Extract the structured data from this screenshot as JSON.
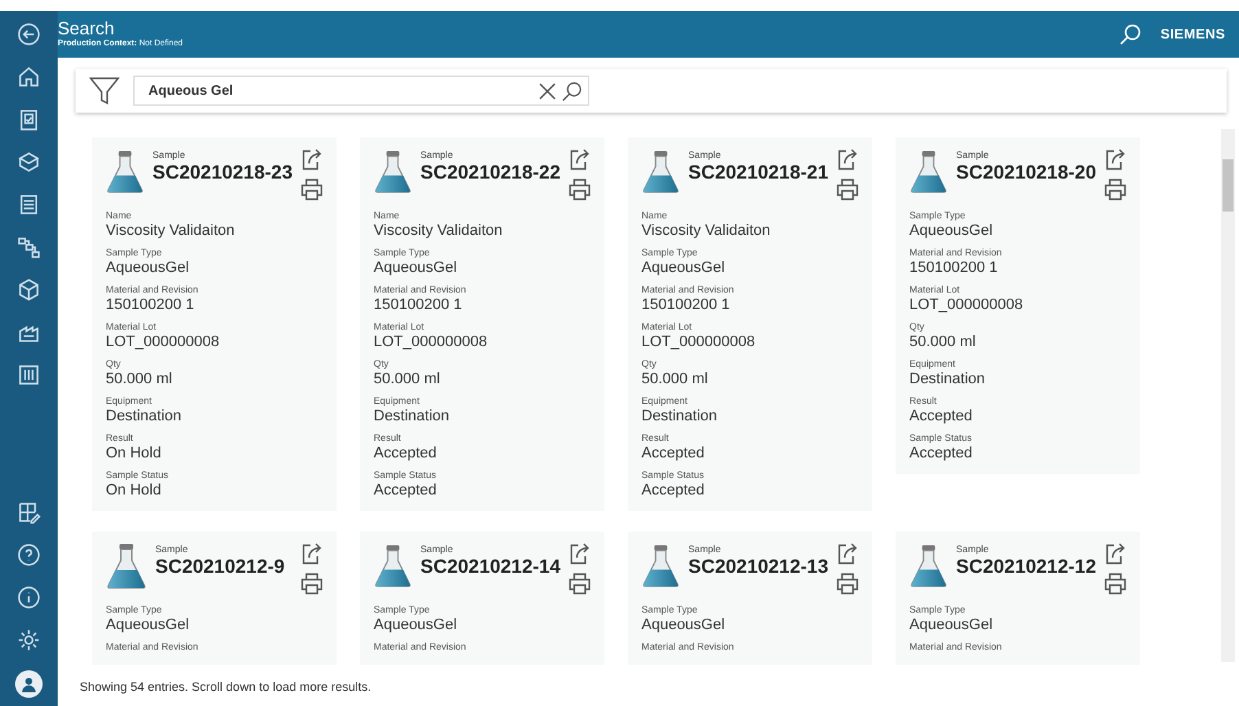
{
  "header": {
    "title": "Search",
    "subtitle": "**Production Context:** Not Defined",
    "brand": "SIEMENS"
  },
  "search": {
    "value": "Aqueous Gel"
  },
  "cards": [
    {
      "caption": "Sample",
      "id": "SC20210218-23",
      "fields": [
        {
          "label": "Name",
          "value": "Viscosity Validaiton"
        },
        {
          "label": "Sample Type",
          "value": "AqueousGel"
        },
        {
          "label": "Material and Revision",
          "value": "150100200 1"
        },
        {
          "label": "Material Lot",
          "value": "LOT_000000008"
        },
        {
          "label": "Qty",
          "value": "50.000 ml"
        },
        {
          "label": "Equipment",
          "value": "Destination"
        },
        {
          "label": "Result",
          "value": "On Hold"
        },
        {
          "label": "Sample Status",
          "value": "On Hold"
        }
      ]
    },
    {
      "caption": "Sample",
      "id": "SC20210218-22",
      "fields": [
        {
          "label": "Name",
          "value": "Viscosity Validaiton"
        },
        {
          "label": "Sample Type",
          "value": "AqueousGel"
        },
        {
          "label": "Material and Revision",
          "value": "150100200 1"
        },
        {
          "label": "Material Lot",
          "value": "LOT_000000008"
        },
        {
          "label": "Qty",
          "value": "50.000 ml"
        },
        {
          "label": "Equipment",
          "value": "Destination"
        },
        {
          "label": "Result",
          "value": "Accepted"
        },
        {
          "label": "Sample Status",
          "value": "Accepted"
        }
      ]
    },
    {
      "caption": "Sample",
      "id": "SC20210218-21",
      "fields": [
        {
          "label": "Name",
          "value": "Viscosity Validaiton"
        },
        {
          "label": "Sample Type",
          "value": "AqueousGel"
        },
        {
          "label": "Material and Revision",
          "value": "150100200 1"
        },
        {
          "label": "Material Lot",
          "value": "LOT_000000008"
        },
        {
          "label": "Qty",
          "value": "50.000 ml"
        },
        {
          "label": "Equipment",
          "value": "Destination"
        },
        {
          "label": "Result",
          "value": "Accepted"
        },
        {
          "label": "Sample Status",
          "value": "Accepted"
        }
      ]
    },
    {
      "caption": "Sample",
      "id": "SC20210218-20",
      "fields": [
        {
          "label": "Sample Type",
          "value": "AqueousGel"
        },
        {
          "label": "Material and Revision",
          "value": "150100200 1"
        },
        {
          "label": "Material Lot",
          "value": "LOT_000000008"
        },
        {
          "label": "Qty",
          "value": "50.000 ml"
        },
        {
          "label": "Equipment",
          "value": "Destination"
        },
        {
          "label": "Result",
          "value": "Accepted"
        },
        {
          "label": "Sample Status",
          "value": "Accepted"
        }
      ]
    },
    {
      "caption": "Sample",
      "id": "SC20210212-9",
      "fields": [
        {
          "label": "Sample Type",
          "value": "AqueousGel"
        },
        {
          "label": "Material and Revision"
        }
      ]
    },
    {
      "caption": "Sample",
      "id": "SC20210212-14",
      "fields": [
        {
          "label": "Sample Type",
          "value": "AqueousGel"
        },
        {
          "label": "Material and Revision"
        }
      ]
    },
    {
      "caption": "Sample",
      "id": "SC20210212-13",
      "fields": [
        {
          "label": "Sample Type",
          "value": "AqueousGel"
        },
        {
          "label": "Material and Revision"
        }
      ]
    },
    {
      "caption": "Sample",
      "id": "SC20210212-12",
      "fields": [
        {
          "label": "Sample Type",
          "value": "AqueousGel"
        },
        {
          "label": "Material and Revision"
        }
      ]
    }
  ],
  "status_bar": "Showing 54 entries. Scroll down to load more results."
}
